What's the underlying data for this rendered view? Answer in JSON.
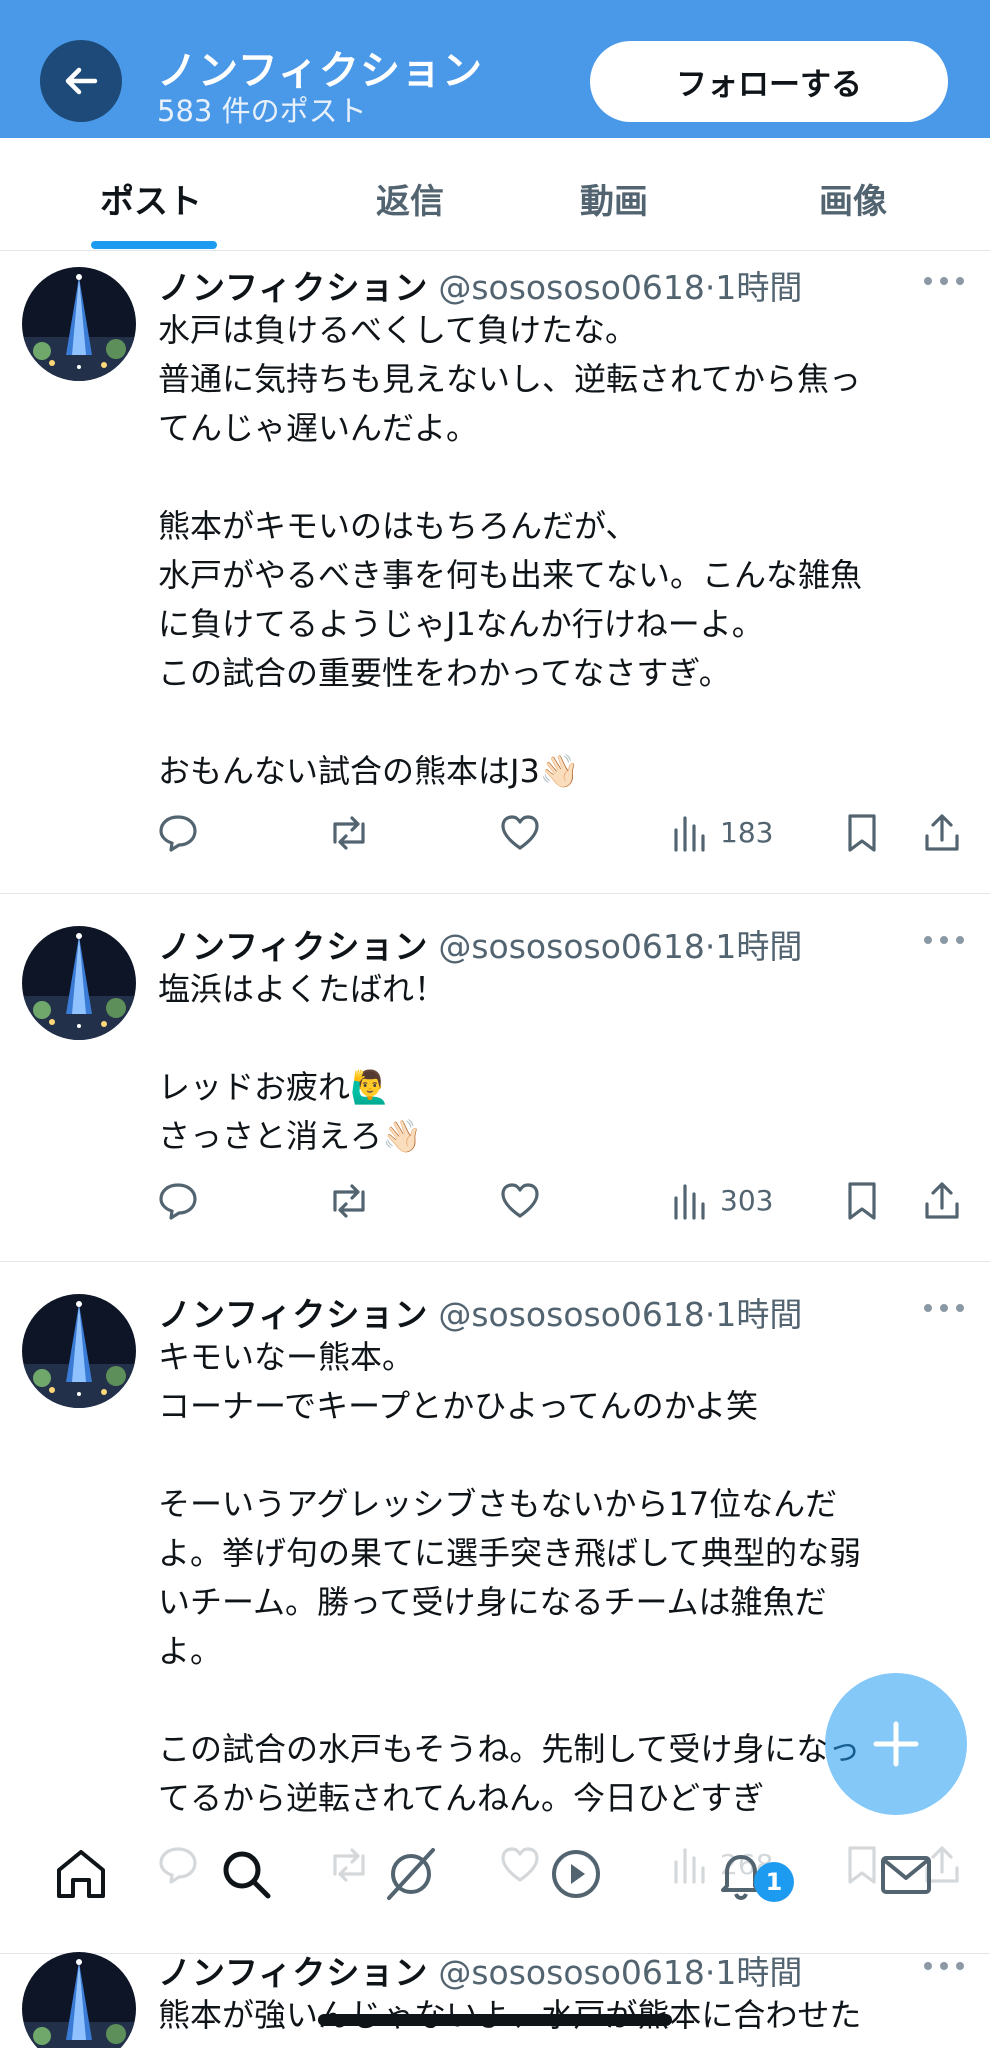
{
  "header": {
    "title": "ノンフィクション",
    "post_count": "583 件のポスト",
    "follow_label": "フォローする"
  },
  "tabs": [
    {
      "label": "ポスト",
      "active": true
    },
    {
      "label": "返信"
    },
    {
      "label": "動画"
    },
    {
      "label": "画像"
    }
  ],
  "posts": [
    {
      "name": "ノンフィクション",
      "handle": "@sosososo0618",
      "time": "·1時間",
      "text": "水戸は負けるべくして負けたな。\n普通に気持ちも見えないし、逆転されてから焦っ\nてんじゃ遅いんだよ。\n\n熊本がキモいのはもちろんだが、\n水戸がやるべき事を何も出来てない。こんな雑魚\nに負けてるようじゃJ1なんか行けねーよ。\nこの試合の重要性をわかってなさすぎ。\n\nおもんない試合の熊本はJ3👋🏻",
      "views": "183"
    },
    {
      "name": "ノンフィクション",
      "handle": "@sosososo0618",
      "time": "·1時間",
      "text": "塩浜はよくたばれ！\n\nレッドお疲れ🙋‍♂️\nさっさと消えろ👋🏻",
      "views": "303"
    },
    {
      "name": "ノンフィクション",
      "handle": "@sosososo0618",
      "time": "·1時間",
      "text": "キモいなー熊本。\nコーナーでキープとかひよってんのかよ笑\n\nそーいうアグレッシブさもないから17位なんだ\nよ。挙げ句の果てに選手突き飛ばして典型的な弱\nいチーム。勝って受け身になるチームは雑魚だ\nよ。\n\nこの試合の水戸もそうね。先制して受け身になっ\nてるから逆転されてんねん。今日ひどすぎ",
      "views": "268"
    },
    {
      "name": "ノンフィクション",
      "handle": "@sosososo0618",
      "time": "·1時間",
      "text": "熊本が強いんじゃないよ、水戸が熊本に合わせた"
    }
  ],
  "notifications_badge": "1",
  "colors": {
    "header_bg": "#4a99e9",
    "accent": "#1d9bf0",
    "text": "#0f1419",
    "muted": "#536471"
  }
}
